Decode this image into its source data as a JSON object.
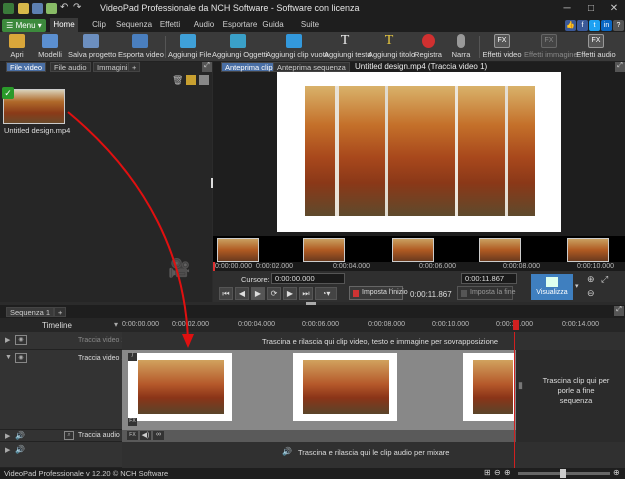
{
  "window": {
    "title": "VideoPad Professionale da NCH Software - Software con licenza"
  },
  "menubar": {
    "menu_label": "Menu",
    "tabs": [
      "Home",
      "Clip",
      "Sequenza",
      "Effetti",
      "Audio",
      "Esportare",
      "Guida",
      "Suite"
    ]
  },
  "toolbar": {
    "items": [
      {
        "label": "Apri",
        "icon": "open-folder-icon"
      },
      {
        "label": "Modelli",
        "icon": "templates-icon"
      },
      {
        "label": "Salva progetto",
        "icon": "save-icon"
      },
      {
        "label": "Esporta video",
        "icon": "export-video-icon"
      },
      {
        "label": "Aggiungi File",
        "icon": "add-file-icon"
      },
      {
        "label": "Aggiungi Oggetti",
        "icon": "add-objects-icon"
      },
      {
        "label": "Aggiungi clip vuota",
        "icon": "blank-clip-icon"
      },
      {
        "label": "Aggiungi testo",
        "icon": "text-icon"
      },
      {
        "label": "Aggiungi titolo",
        "icon": "title-icon"
      },
      {
        "label": "Registra",
        "icon": "record-icon"
      },
      {
        "label": "Narra",
        "icon": "microphone-icon"
      },
      {
        "label": "Effetti video",
        "icon": "video-effects-icon"
      },
      {
        "label": "Effetti immagine",
        "icon": "image-effects-icon"
      },
      {
        "label": "Effetti audio",
        "icon": "audio-effects-icon"
      }
    ]
  },
  "bins": {
    "tabs": [
      "File video",
      "File audio",
      "Immagini",
      "+"
    ],
    "clips": [
      {
        "name": "Untitled design.mp4"
      }
    ]
  },
  "preview": {
    "tabs": [
      "Anteprima clip",
      "Anteprima sequenza"
    ],
    "title": "Untitled design.mp4 (Traccia video 1)",
    "ruler": [
      "0:00:00.000",
      "0:00:02.000",
      "0:00:04.000",
      "0:00:06.000",
      "0:00:08.000",
      "0:00:10.000"
    ],
    "cursor_label": "Cursore:",
    "cursor_value": "0:00:00.000",
    "length_value": "0:00:11.867",
    "duration": "0:00:11.867",
    "set_start": "Imposta l'inizio",
    "set_end": "Imposta la fine",
    "view_label": "Visualizza"
  },
  "sequence": {
    "tab": "Sequenza 1",
    "timeline_label": "Timeline",
    "ruler": [
      "0:00:00.000",
      "0:00:02.000",
      "0:00:04.000",
      "0:00:06.000",
      "0:00:08.000",
      "0:00:10.000",
      "0:00:12.000",
      "0:00:14.000"
    ],
    "tracks": {
      "video2": "Traccia video 2",
      "video1": "Traccia video 1",
      "audio1": "Traccia audio 1",
      "audio2": ""
    },
    "hint_top": "Trascina e rilascia qui clip video, testo e immagine per sovrapposizione",
    "hint_right": "Trascina clip qui per porle a fine sequenza",
    "hint_audio": "Trascina e rilascia qui le clip audio per mixare"
  },
  "status": {
    "text": "VideoPad Professionale v 12.20 © NCH Software"
  }
}
